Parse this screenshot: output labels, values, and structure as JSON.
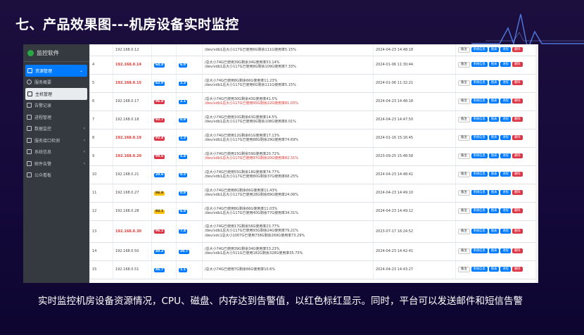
{
  "slide": {
    "title": "七、产品效果图---机房设备实时监控",
    "caption": "实时监控机房设备资源情况，CPU、磁盘、内存达到告警值，以红色标红显示。同时，平台可以发送邮件和短信告警"
  },
  "colors": {
    "accent": "#007bff",
    "alert": "#dc3545",
    "sidebar": "#343a40",
    "slide_bg": "#1c0f3e"
  },
  "app": {
    "name": "监控软件",
    "sidebar": [
      {
        "label": "资源管理",
        "icon": "dashboard-icon",
        "state": "active",
        "chevron": "⌄"
      },
      {
        "label": "服务概要",
        "icon": "circle-icon",
        "state": "",
        "chevron": ""
      },
      {
        "label": "主机管理",
        "icon": "monitor-icon",
        "state": "current",
        "chevron": ""
      },
      {
        "label": "告警记录",
        "icon": "log-icon",
        "state": "",
        "chevron": ""
      },
      {
        "label": "进程管理",
        "icon": "list-icon",
        "state": "",
        "chevron": ""
      },
      {
        "label": "数据监控",
        "icon": "grid-icon",
        "state": "",
        "chevron": "‹"
      },
      {
        "label": "服务接口检测",
        "icon": "link-icon",
        "state": "",
        "chevron": "‹"
      },
      {
        "label": "系统信息",
        "icon": "cube-icon",
        "state": "",
        "chevron": "‹"
      },
      {
        "label": "邮件告警",
        "icon": "mail-icon",
        "state": "",
        "chevron": "‹"
      },
      {
        "label": "公众看板",
        "icon": "board-icon",
        "state": "",
        "chevron": ""
      }
    ],
    "buttons": {
      "note": "备注",
      "sys": "系统信息",
      "chart": "图表",
      "proc": "进程",
      "del": "删除"
    },
    "rows": [
      {
        "no": "",
        "ip": "192.168.0.12",
        "ip_red": false,
        "cpu": "",
        "cpu_color": "b-blue",
        "load": "",
        "disk": [
          "",
          "/dev/vdb1总大小117G已使用6G剩余111G使用率5.15%"
        ],
        "disk_red": [
          false,
          false
        ],
        "time": "2024-04-23 14:48:18"
      },
      {
        "no": "4",
        "ip": "192.168.0.14",
        "ip_red": true,
        "cpu": "64.4",
        "cpu_color": "b-blue",
        "load": "6.0",
        "disk": [
          "/总大小74G已使用39G剩余34G使用率53.14%",
          "/dev/vdb1总大小117G已使用8G剩余109G使用率7.33%"
        ],
        "disk_red": [
          false,
          false
        ],
        "time": "2024-01-06 11:30:44"
      },
      {
        "no": "5",
        "ip": "192.168.0.15",
        "ip_red": true,
        "cpu": "62.9",
        "cpu_color": "b-blue",
        "load": "2.3",
        "disk": [
          "/总大小74G已使用8G剩余66G使用率11.23%",
          "/dev/vdb1总大小117G已使用6G剩余111G使用率5.15%"
        ],
        "disk_red": [
          false,
          false
        ],
        "time": "2024-01-06 11:32:21"
      },
      {
        "no": "6",
        "ip": "192.168.0.17",
        "ip_red": false,
        "cpu": "96.8",
        "cpu_color": "b-red",
        "load": "2.1",
        "disk": [
          "/总大小74G已使用30G剩余43G使用率41.5%",
          "/dev/vdb1总大小117G已使用95G剩余22G使用率81.05%"
        ],
        "disk_red": [
          false,
          true
        ],
        "time": "2024-04-23 14:48:18"
      },
      {
        "no": "7",
        "ip": "192.168.0.18",
        "ip_red": false,
        "cpu": "92.7",
        "cpu_color": "b-red",
        "load": "0.9",
        "disk": [
          "/总大小74G已使用10G剩余63G使用率14.5%",
          "/dev/vdb1总大小117G已使用9G剩余108G使用率8.01%"
        ],
        "disk_red": [
          false,
          false
        ],
        "time": "2024-04-23 14:47:50"
      },
      {
        "no": "8",
        "ip": "192.168.0.19",
        "ip_red": true,
        "cpu": "92.4",
        "cpu_color": "b-red",
        "load": "1.3",
        "disk": [
          "/总大小74G已使用12G剩余61G使用率17.13%",
          "/dev/vdb1总大小117G已使用88G剩余29G使用率74.69%"
        ],
        "disk_red": [
          false,
          false
        ],
        "time": "2024-01-16 15:16:45"
      },
      {
        "no": "9",
        "ip": "192.168.0.20",
        "ip_red": true,
        "cpu": "99.6",
        "cpu_color": "b-red",
        "load": "5.4",
        "disk": [
          "/总大小74G已使用15G剩余59G使用率20.72%",
          "/dev/vdb1总大小117G已使用97G剩余20G使用率82.31%"
        ],
        "disk_red": [
          false,
          true
        ],
        "time": "2023-09-25 15:48:58"
      },
      {
        "no": "10",
        "ip": "192.168.0.21",
        "ip_red": false,
        "cpu": "29.6",
        "cpu_color": "b-blue",
        "load": "0.5",
        "disk": [
          "/总大小74G已使用55G剩余18G使用率74.77%",
          "/dev/vdb1总大小117G已使用80G剩余37G使用率68.25%"
        ],
        "disk_red": [
          false,
          false
        ],
        "time": "2024-04-23 14:48:41"
      },
      {
        "no": "11",
        "ip": "192.168.0.27",
        "ip_red": false,
        "cpu": "86.8",
        "cpu_color": "b-yellow",
        "load": "0.8",
        "disk": [
          "/总大小74G已使用8G剩余66G使用率11.43%",
          "/dev/vdb1总大小117G已使用28G剩余89G使用率24.06%"
        ],
        "disk_red": [
          false,
          false
        ],
        "time": "2024-04-23 14:49:10"
      },
      {
        "no": "12",
        "ip": "192.168.0.28",
        "ip_red": false,
        "cpu": "84.1",
        "cpu_color": "b-yellow",
        "load": "6.8",
        "disk": [
          "/总大小74G已使用8G剩余66G使用率11.03%",
          "/dev/vdb1总大小117G已使用40G剩余77G使用率34.31%"
        ],
        "disk_red": [
          false,
          false
        ],
        "time": "2024-04-23 14:49:12"
      },
      {
        "no": "13",
        "ip": "192.168.0.30",
        "ip_red": true,
        "cpu": "96.1",
        "cpu_color": "b-red",
        "load": "7.4",
        "disk": [
          "/总大小74G已使用17G剩余56G使用率23.77%",
          "/dev/vdb1总大小117G已使用93G剩余24G使用率79.21%",
          "/dev/vdc1总大小1007G已使用738G剩余269G使用率73.29%"
        ],
        "disk_red": [
          false,
          false,
          false
        ],
        "time": "2023-07-17 16:24:52"
      },
      {
        "no": "14",
        "ip": "192.168.0.50",
        "ip_red": false,
        "cpu": "49.2",
        "cpu_color": "b-blue",
        "load": "20.7",
        "disk": [
          "/总大小74G已使用39G剩余34G使用率53.23%",
          "/dev/vdb1总大小511G已使用182G剩余328G使用率35.75%"
        ],
        "disk_red": [
          false,
          false
        ],
        "time": "2024-04-23 14:42:41"
      },
      {
        "no": "15",
        "ip": "192.168.0.51",
        "ip_red": false,
        "cpu": "46.7",
        "cpu_color": "b-blue",
        "load": "1.1",
        "disk": [
          "/总大小74G已使用7G剩余66G使用率10.6%",
          ""
        ],
        "disk_red": [
          false,
          false
        ],
        "time": "2024-04-23 14:43:27"
      }
    ]
  }
}
